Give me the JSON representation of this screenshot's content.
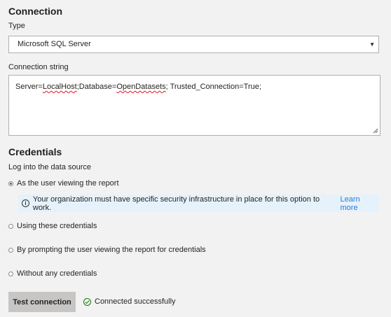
{
  "connection": {
    "title": "Connection",
    "type_label": "Type",
    "type_selected": "Microsoft SQL Server",
    "conn_string_label": "Connection string",
    "conn_string_parts": {
      "p1": "Server=",
      "p2": "LocalHost",
      "p3": ";Database=",
      "p4": "OpenDatasets",
      "p5": "; Trusted_Connection=True;"
    }
  },
  "credentials": {
    "title": "Credentials",
    "login_label": "Log into the data source",
    "options": [
      {
        "label": "As the user viewing the report",
        "selected": true
      },
      {
        "label": "Using these credentials",
        "selected": false
      },
      {
        "label": "By prompting the user viewing the report for credentials",
        "selected": false
      },
      {
        "label": "Without any credentials",
        "selected": false
      }
    ],
    "info_message": "Your organization must have specific security infrastructure in place for this option to work.",
    "info_link": "Learn more"
  },
  "actions": {
    "test_button_label": "Test connection",
    "status_text": "Connected successfully"
  },
  "icons": {
    "info": "info-icon",
    "success": "check-circle-icon",
    "dropdown": "caret-down-icon"
  },
  "colors": {
    "background": "#f2f2f2",
    "link": "#2c7ad6",
    "info_bg": "#e6f2fb",
    "button_bg": "#c8c6c4",
    "success": "#107c10"
  }
}
